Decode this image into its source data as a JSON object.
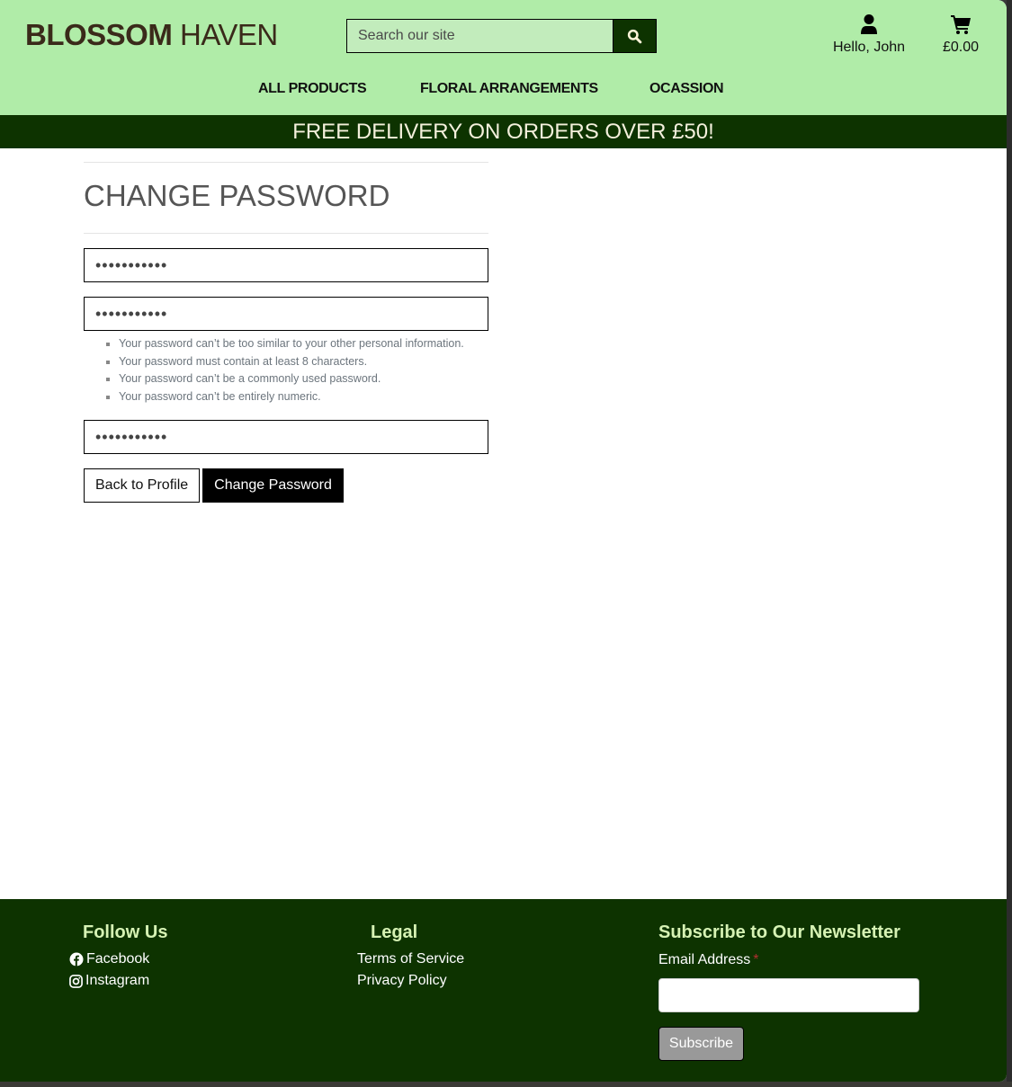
{
  "brand": {
    "name_bold": "BLOSSOM",
    "name_light": "HAVEN"
  },
  "search": {
    "placeholder": "Search our site",
    "icon": "search-icon"
  },
  "account": {
    "label": "Hello, John",
    "icon": "user-icon"
  },
  "cart": {
    "total": "£0.00",
    "icon": "shopping-cart-icon"
  },
  "nav": {
    "items": [
      {
        "label": "ALL PRODUCTS"
      },
      {
        "label": "FLORAL ARRANGEMENTS"
      },
      {
        "label": "OCASSION"
      }
    ]
  },
  "banner": {
    "text": "FREE DELIVERY ON ORDERS OVER £50!"
  },
  "main": {
    "title": "CHANGE PASSWORD",
    "fields": {
      "old_password": {
        "value": "•••••••••••"
      },
      "new_password1": {
        "value": "•••••••••••"
      },
      "new_password2": {
        "value": "•••••••••••"
      }
    },
    "help_text": [
      "Your password can’t be too similar to your other personal information.",
      "Your password must contain at least 8 characters.",
      "Your password can’t be a commonly used password.",
      "Your password can’t be entirely numeric."
    ],
    "back_button": "Back to Profile",
    "submit_button": "Change Password"
  },
  "footer": {
    "follow": {
      "heading": "Follow Us",
      "links": [
        {
          "label": "Facebook",
          "icon": "facebook-icon"
        },
        {
          "label": "Instagram",
          "icon": "instagram-icon"
        }
      ]
    },
    "legal": {
      "heading": "Legal",
      "links": [
        {
          "label": "Terms of Service"
        },
        {
          "label": "Privacy Policy"
        }
      ]
    },
    "newsletter": {
      "heading": "Subscribe to Our Newsletter",
      "email_label": "Email Address",
      "required_marker": "*",
      "email_value": "",
      "button": "Subscribe"
    }
  },
  "colors": {
    "header_bg": "#b0eca8",
    "dark_green": "#0d3300",
    "footer_heading": "#d6f2b4"
  }
}
